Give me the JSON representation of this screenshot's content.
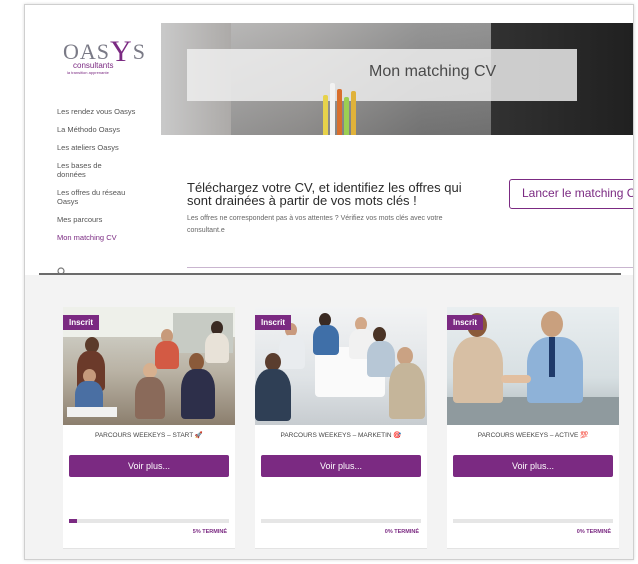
{
  "brand": {
    "logo_main": "OASYS",
    "logo_sub": "consultants",
    "logo_tagline": "la transition apprenante"
  },
  "sidebar": {
    "items": [
      {
        "label": "Les rendez vous Oasys",
        "active": false
      },
      {
        "label": "La Méthodo Oasys",
        "active": false
      },
      {
        "label": "Les ateliers Oasys",
        "active": false
      },
      {
        "label": "Les bases de données",
        "active": false
      },
      {
        "label": "Les offres du réseau Oasys",
        "active": false
      },
      {
        "label": "Mes parcours",
        "active": false
      },
      {
        "label": "Mon matching CV",
        "active": true
      }
    ],
    "search_icon": "search-icon"
  },
  "hero": {
    "title": "Mon matching CV"
  },
  "cta": {
    "title": "Téléchargez votre CV, et identifiez les offres qui sont drainées à partir de vos mots clés !",
    "description": "Les offres ne correspondent pas à vos attentes ? Vérifiez vos mots clés avec votre consultant.e",
    "button_label": "Lancer le matching CV"
  },
  "courses": [
    {
      "badge": "Inscrit",
      "title": "PARCOURS WEEKEYS – START 🚀",
      "button": "Voir plus...",
      "progress": 5,
      "progress_label": "5% TERMINÉ"
    },
    {
      "badge": "Inscrit",
      "title": "PARCOURS WEEKEYS – MARKETIN 🎯",
      "button": "Voir plus...",
      "progress": 0,
      "progress_label": "0% TERMINÉ"
    },
    {
      "badge": "Inscrit",
      "title": "PARCOURS WEEKEYS – ACTIVE 💯",
      "button": "Voir plus...",
      "progress": 0,
      "progress_label": "0% TERMINÉ"
    }
  ],
  "colors": {
    "accent": "#7b2a82",
    "text": "#2b2b2b"
  }
}
